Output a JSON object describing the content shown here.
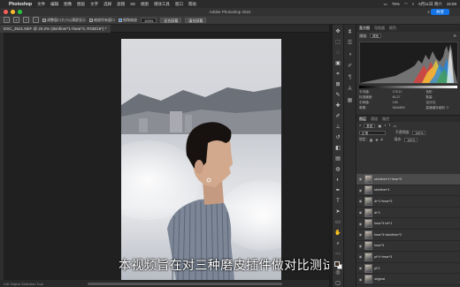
{
  "menubar": {
    "app_name": "Photoshop",
    "items": [
      "文件",
      "编辑",
      "图像",
      "图层",
      "文字",
      "选择",
      "滤镜",
      "3D",
      "视图",
      "增效工具",
      "窗口",
      "帮助"
    ],
    "battery": "76%",
    "date": "6月11日 周六",
    "time": "16:59"
  },
  "titlebar": {
    "title": "Adobe Photoshop 2022",
    "share_label": "共享"
  },
  "options": {
    "checkbox1_label": "调整窗口大小以满屏显示",
    "checkbox2_label": "缩放所有窗口",
    "checkbox3_label": "细微缩放",
    "zoom_value": "100%",
    "btn_fit": "适合屏幕",
    "btn_fill": "填充屏幕"
  },
  "doc": {
    "tab_title": "DSC_3521.NEF @ 20.2% (skinfiner*1+hear*3, RGB/16*) *"
  },
  "canvas": {
    "subtitle": "本视频旨在对三种磨皮插件做对比测试"
  },
  "status": {
    "tool_hint": "Ctrl Object Selection Tool"
  },
  "panels": {
    "top_tabs": [
      "直方图",
      "导航器",
      "颜色"
    ],
    "channel_label": "通道:",
    "channel_value": "颜色",
    "stats": [
      [
        "平均值:",
        "178.11",
        "色阶:"
      ],
      [
        "标准偏差:",
        "60.27",
        "数量:"
      ],
      [
        "中间值:",
        "196",
        "百分位:"
      ],
      [
        "像素:",
        "5644800",
        "高速缓存级别: 3"
      ]
    ],
    "layers_tabs": [
      "图层",
      "通道",
      "路径"
    ],
    "kind_label": "类型",
    "blend_mode": "正常",
    "opacity_label": "不透明度:",
    "opacity_value": "100%",
    "lock_label": "锁定:",
    "fill_label": "填充:",
    "fill_value": "100%",
    "layers": [
      "skinfiner*1+hear*3",
      "skinfiner*1",
      "dr*1+hear*3",
      "dr*1",
      "hear*3+dr*1",
      "hear*3+skinfiner*2",
      "hear*3",
      "pt*1+hear*3",
      "pt*1",
      "original"
    ]
  },
  "colors": {
    "accent": "#1473e6",
    "panel_bg": "#323232",
    "canvas_bg": "#202020"
  }
}
